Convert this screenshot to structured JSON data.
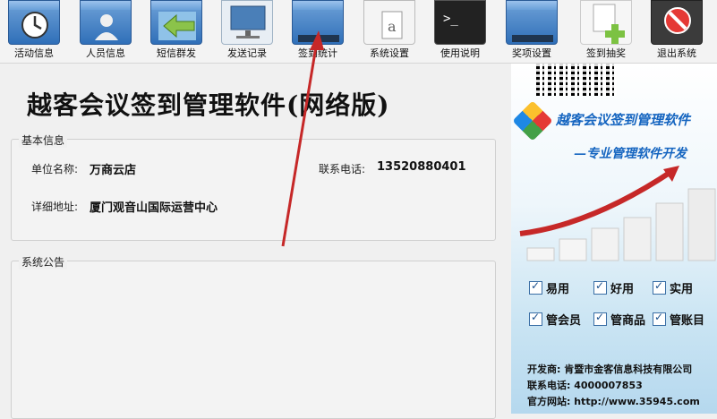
{
  "toolbar": {
    "buttons": [
      {
        "label": "活动信息",
        "icon": "history-clock-icon"
      },
      {
        "label": "人员信息",
        "icon": "person-folder-icon"
      },
      {
        "label": "短信群发",
        "icon": "arrow-left-icon"
      },
      {
        "label": "发送记录",
        "icon": "monitor-icon"
      },
      {
        "label": "签到统计",
        "icon": "folder-icon"
      },
      {
        "label": "系统设置",
        "icon": "document-a-icon"
      },
      {
        "label": "使用说明",
        "icon": "terminal-icon"
      },
      {
        "label": "奖项设置",
        "icon": "folder-icon"
      },
      {
        "label": "签到抽奖",
        "icon": "add-document-icon"
      },
      {
        "label": "退出系统",
        "icon": "stop-icon"
      }
    ]
  },
  "main": {
    "title": "越客会议签到管理软件(网络版)",
    "basic_info": {
      "legend": "基本信息",
      "unit_label": "单位名称:",
      "unit_value": "万商云店",
      "phone_label": "联系电话:",
      "phone_value": "13520880401",
      "address_label": "详细地址:",
      "address_value": "厦门观音山国际运营中心"
    },
    "notice": {
      "legend": "系统公告"
    }
  },
  "side": {
    "brand": "越客会议签到管理软件",
    "slogan": "—专业管理软件开发",
    "features": [
      "易用",
      "好用",
      "实用",
      "管会员",
      "管商品",
      "管账目"
    ],
    "developer": "开发商: 肯暨市金客信息科技有限公司",
    "phone": "联系电话: 4000007853",
    "website": "官方网站: http://www.35945.com"
  },
  "colors": {
    "accent_blue": "#1565c0",
    "arrow_red": "#c62828"
  }
}
